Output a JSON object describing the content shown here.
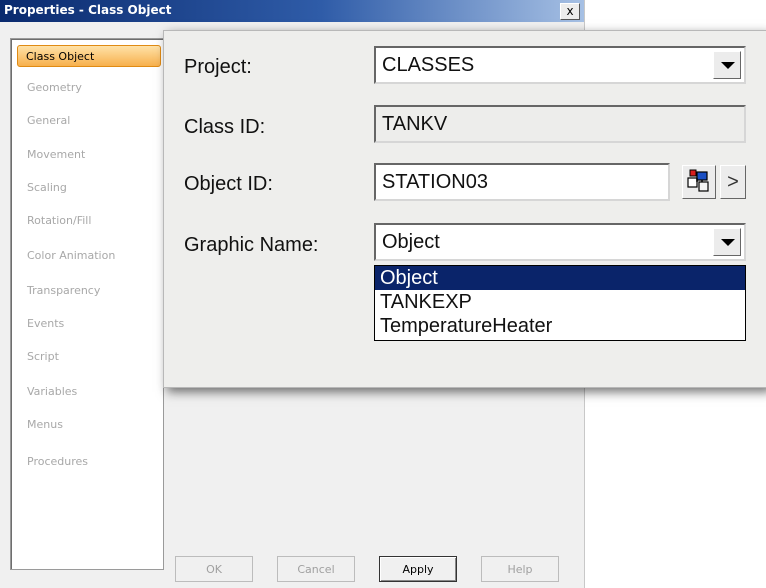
{
  "window": {
    "title": "Properties - Class Object",
    "close_label": "x"
  },
  "nav": {
    "items": [
      {
        "label": "Class Object",
        "active": true
      },
      {
        "label": "Geometry"
      },
      {
        "label": "General"
      },
      {
        "label": "Movement"
      },
      {
        "label": "Scaling"
      },
      {
        "label": "Rotation/Fill"
      },
      {
        "label": "Color Animation"
      },
      {
        "label": "Transparency"
      },
      {
        "label": "Events"
      },
      {
        "label": "Script"
      },
      {
        "label": "Variables"
      },
      {
        "label": "Menus"
      },
      {
        "label": "Procedures"
      }
    ]
  },
  "form": {
    "project_label": "Project:",
    "project_value": "CLASSES",
    "class_id_label": "Class ID:",
    "class_id_value": "TANKV",
    "object_id_label": "Object ID:",
    "object_id_value": "STATION03",
    "object_browse_label": ">",
    "graphic_name_label": "Graphic Name:",
    "graphic_name_value": "Object",
    "graphic_options": [
      "Object",
      "TANKEXP",
      "TemperatureHeater"
    ],
    "graphic_selected": "Object"
  },
  "buttons": {
    "ok": "OK",
    "cancel": "Cancel",
    "apply": "Apply",
    "help": "Help"
  },
  "colors": {
    "title_start": "#0a2a6e",
    "active_tab": "#f7b04d",
    "selection": "#0a246a"
  },
  "icons": {
    "object_picker": "object-picker-icon",
    "dropdown": "chevron-down-icon"
  }
}
